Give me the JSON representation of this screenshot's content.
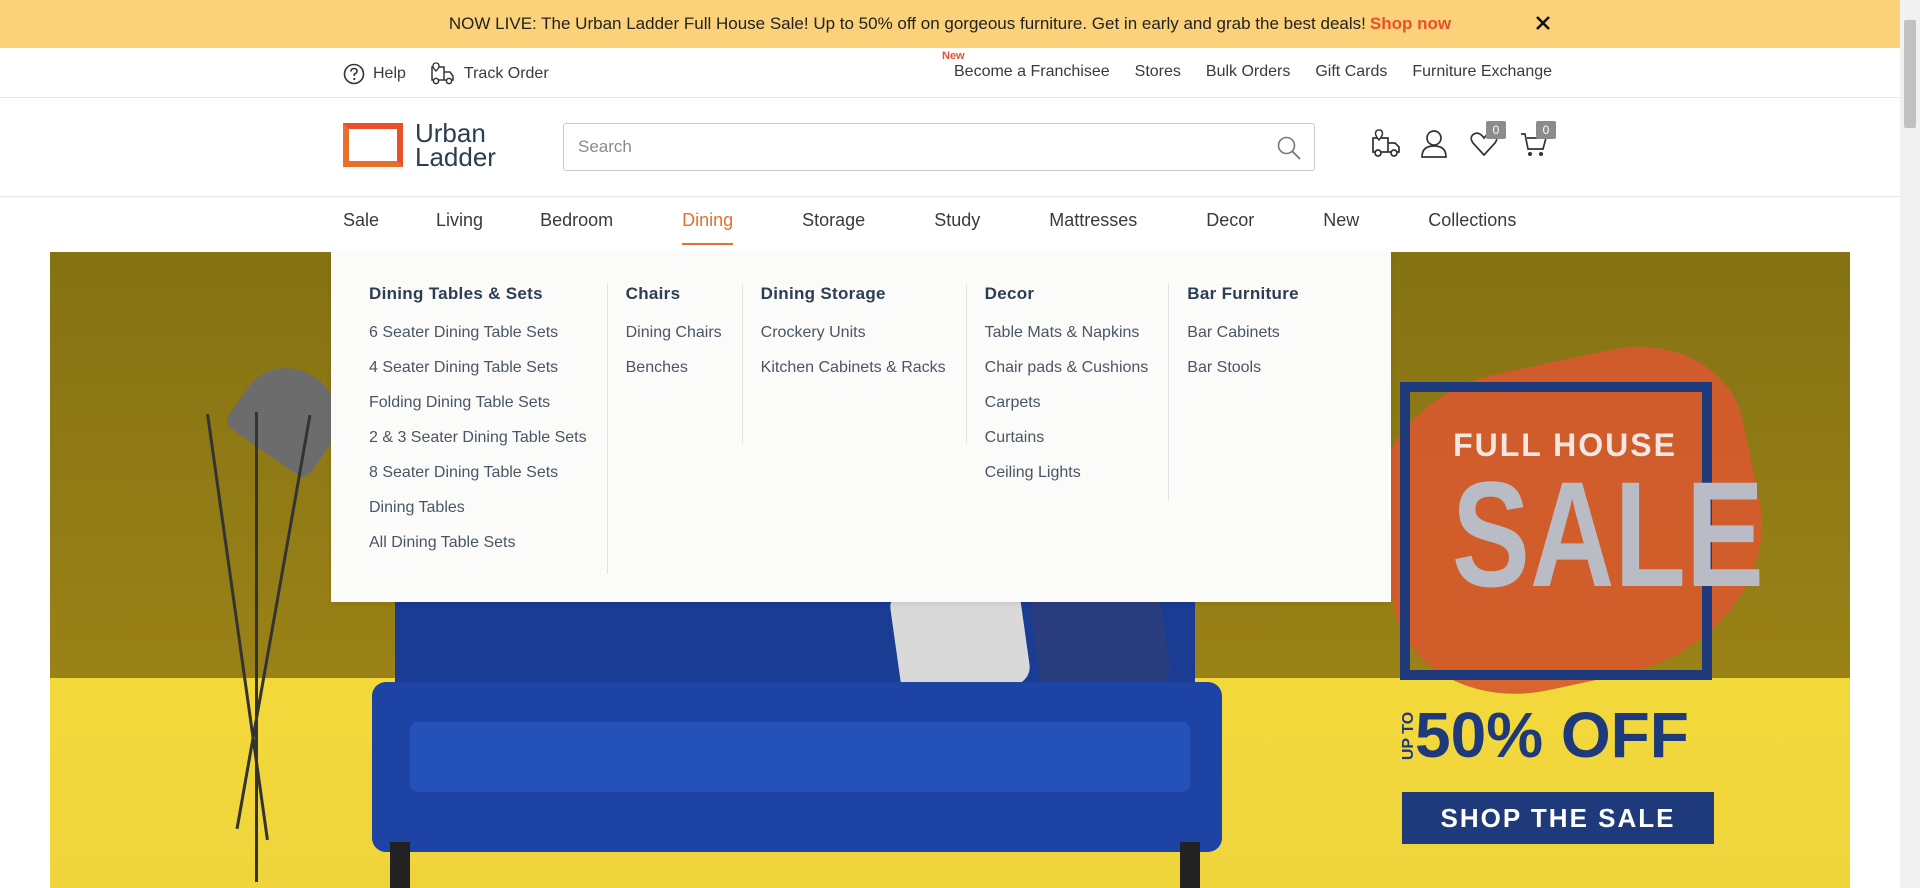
{
  "announcement": {
    "text": "NOW LIVE: The Urban Ladder Full House Sale! Up to 50% off on gorgeous furniture. Get in early and grab the best deals!",
    "link": "Shop now",
    "close_icon": "close-icon"
  },
  "utility": {
    "help": "Help",
    "track_order": "Track Order",
    "new_tag": "New",
    "links": [
      "Become a Franchisee",
      "Stores",
      "Bulk Orders",
      "Gift Cards",
      "Furniture Exchange"
    ]
  },
  "header": {
    "logo_line1": "Urban",
    "logo_line2": "Ladder",
    "search_placeholder": "Search",
    "wishlist_count": "0",
    "cart_count": "0"
  },
  "nav": {
    "items": [
      "Sale",
      "Living",
      "Bedroom",
      "Dining",
      "Storage",
      "Study",
      "Mattresses",
      "Decor",
      "New",
      "Collections"
    ],
    "active": "Dining"
  },
  "dropdown": {
    "columns": [
      {
        "title": "Dining Tables & Sets",
        "links": [
          "6 Seater Dining Table Sets",
          "4 Seater Dining Table Sets",
          "Folding Dining Table Sets",
          "2 & 3 Seater Dining Table Sets",
          "8 Seater Dining Table Sets",
          "Dining Tables",
          "All Dining Table Sets"
        ]
      },
      {
        "title": "Chairs",
        "links": [
          "Dining Chairs",
          "Benches"
        ]
      },
      {
        "title": "Dining Storage",
        "links": [
          "Crockery Units",
          "Kitchen Cabinets & Racks"
        ]
      },
      {
        "title": "Decor",
        "links": [
          "Table Mats & Napkins",
          "Chair pads & Cushions",
          "Carpets",
          "Curtains",
          "Ceiling Lights"
        ]
      },
      {
        "title": "Bar Furniture",
        "links": [
          "Bar Cabinets",
          "Bar Stools"
        ]
      }
    ]
  },
  "hero": {
    "full_house": "FULL HOUSE",
    "sale": "SALE",
    "upto": "UP TO",
    "off": "50% OFF",
    "cta": "SHOP THE SALE"
  },
  "colors": {
    "accent": "#e8702a",
    "banner": "#fbd27a",
    "navy": "#1e3a7a"
  }
}
